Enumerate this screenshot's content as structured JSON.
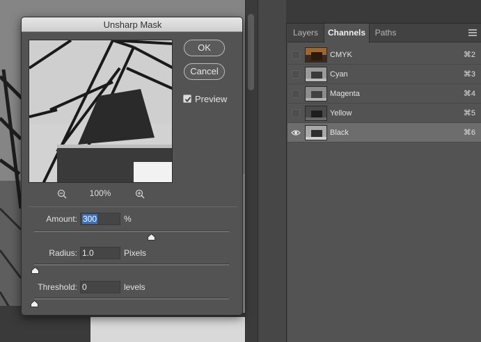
{
  "dialog": {
    "title": "Unsharp Mask",
    "ok_label": "OK",
    "cancel_label": "Cancel",
    "preview_label": "Preview",
    "preview_checked": true,
    "zoom_level": "100%",
    "amount": {
      "label": "Amount:",
      "value": "300",
      "unit": "%",
      "slider_fraction": 0.6
    },
    "radius": {
      "label": "Radius:",
      "value": "1.0",
      "unit": "Pixels",
      "slider_fraction": 0.005
    },
    "threshold": {
      "label": "Threshold:",
      "value": "0",
      "unit": "levels",
      "slider_fraction": 0.0
    }
  },
  "panel": {
    "tabs": [
      "Layers",
      "Channels",
      "Paths"
    ],
    "active_tab": "Channels",
    "channels": [
      {
        "name": "CMYK",
        "shortcut": "⌘2",
        "visible": false,
        "selected": false,
        "thumb": "color"
      },
      {
        "name": "Cyan",
        "shortcut": "⌘3",
        "visible": false,
        "selected": false,
        "thumb": "gray"
      },
      {
        "name": "Magenta",
        "shortcut": "⌘4",
        "visible": false,
        "selected": false,
        "thumb": "gray"
      },
      {
        "name": "Yellow",
        "shortcut": "⌘5",
        "visible": false,
        "selected": false,
        "thumb": "dark"
      },
      {
        "name": "Black",
        "shortcut": "⌘6",
        "visible": true,
        "selected": true,
        "thumb": "gray"
      }
    ]
  },
  "colors": {
    "panel_bg": "#535353",
    "selected_row": "#6d6d6d",
    "field_selection": "#3a73c2"
  }
}
